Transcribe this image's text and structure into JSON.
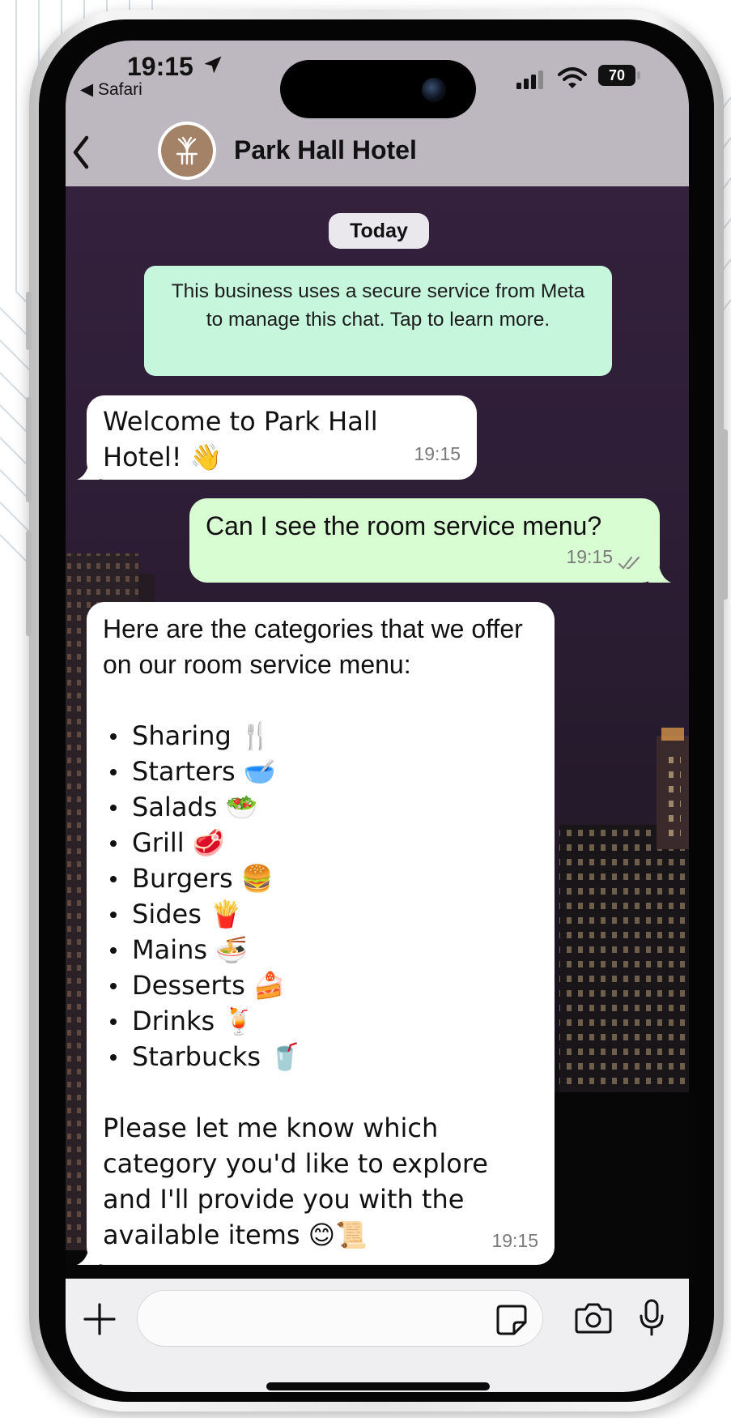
{
  "status_bar": {
    "time": "19:15",
    "back_app": "◀ Safari",
    "battery": "70"
  },
  "header": {
    "contact_name": "Park Hall Hotel"
  },
  "chat": {
    "date_label": "Today",
    "system_note": "This business uses a secure service from Meta to manage this chat. Tap to learn more.",
    "messages": [
      {
        "direction": "incoming",
        "text": "Welcome to Park Hall Hotel! 👋",
        "time": "19:15"
      },
      {
        "direction": "outgoing",
        "text": "Can I see the room service menu?",
        "time": "19:15",
        "status": "read"
      },
      {
        "direction": "incoming",
        "intro": "Here are the categories that we offer on our room service menu:",
        "items": [
          "Sharing 🍴",
          "Starters 🥣",
          "Salads 🥗",
          "Grill 🥩",
          "Burgers 🍔",
          "Sides 🍟",
          "Mains 🍜",
          "Desserts 🍰",
          "Drinks 🍹",
          "Starbucks 🥤"
        ],
        "outro": "Please let me know which category you'd like to explore and I'll provide you with the available items 😊📜",
        "time": "19:15"
      }
    ]
  },
  "colors": {
    "outgoing_bubble": "#d9fdd3",
    "incoming_bubble": "#ffffff",
    "system_note": "#c6f6dc",
    "header_bg": "#bdb8bf",
    "hotel_brand": "#a48267"
  },
  "icons": {
    "status": [
      "location-arrow-icon",
      "signal-icon",
      "wifi-icon",
      "battery-icon"
    ],
    "header": [
      "back-chevron-icon",
      "hotel-logo-icon"
    ],
    "composer": [
      "plus-icon",
      "sticker-icon",
      "camera-icon",
      "microphone-icon"
    ]
  }
}
